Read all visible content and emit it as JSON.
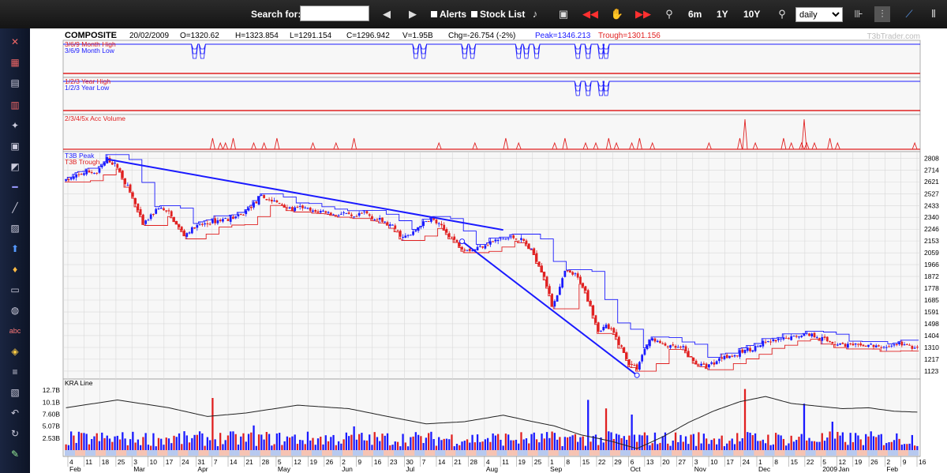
{
  "toolbar": {
    "search_label": "Search for:",
    "search_value": "",
    "alerts_label": "Alerts",
    "stocklist_label": "Stock List",
    "range_6m": "6m",
    "range_1y": "1Y",
    "range_10y": "10Y",
    "period_value": "daily",
    "period_options": [
      "daily"
    ]
  },
  "icons": {
    "prev": "chevron-left-icon",
    "next": "chevron-right-icon",
    "bell": "bell-icon",
    "camera": "camera-icon",
    "rewind": "rewind-icon",
    "hand": "hand-icon",
    "forward": "fast-forward-icon",
    "zoom_in": "zoom-in-icon",
    "zoom_out": "zoom-out-icon"
  },
  "colors": {
    "up": "#1a1aff",
    "down": "#e02020",
    "peak": "#1a1aff",
    "trough": "#e02020",
    "grid": "#d8d8d8",
    "plot_bg": "#f7f7f7",
    "accent_band_a": "#b7c9ef",
    "accent_band_b": "#f6c3b3"
  },
  "header": {
    "symbol": "COMPOSITE",
    "date": "20/02/2009",
    "open": "O=1320.62",
    "high": "H=1323.854",
    "low": "L=1291.154",
    "close": "C=1296.942",
    "volume": "V=1.95B",
    "change": "Chg=-26.754 (-2%)",
    "peak": "Peak=1346.213",
    "trough": "Trough=1301.156",
    "watermark": "T3bTrader.com"
  },
  "panels": {
    "month_high": "3/6/9 Month High",
    "month_low": "3/6/9 Month Low",
    "year_high": "1/2/3 Year High",
    "year_low": "1/2/3 Year Low",
    "acc_volume": "2/3/4/5x Acc Volume",
    "t3b_peak": "T3B Peak",
    "t3b_trough": "T3B Trough",
    "kra": "KRA Line"
  },
  "chart_data": {
    "type": "candlestick",
    "price_axis": {
      "ticks": [
        2808,
        2714,
        2621,
        2527,
        2433,
        2340,
        2246,
        2153,
        2059,
        1966,
        1872,
        1778,
        1685,
        1591,
        1498,
        1404,
        1310,
        1217,
        1123
      ],
      "ylim": [
        1060,
        2860
      ]
    },
    "volume_axis": {
      "ticks": [
        "12.7B",
        "10.1B",
        "7.60B",
        "5.07B",
        "2.53B"
      ],
      "values": [
        12.7,
        10.1,
        7.6,
        5.07,
        2.53
      ],
      "ylim": [
        0,
        14
      ]
    },
    "x_axis": {
      "day_labels": [
        "4",
        "11",
        "18",
        "25",
        "3",
        "10",
        "17",
        "24",
        "31",
        "7",
        "14",
        "21",
        "28",
        "5",
        "12",
        "19",
        "26",
        "2",
        "9",
        "16",
        "23",
        "30",
        "7",
        "14",
        "21",
        "28",
        "4",
        "11",
        "19",
        "25",
        "1",
        "8",
        "15",
        "22",
        "29",
        "6",
        "13",
        "20",
        "27",
        "3",
        "10",
        "17",
        "24",
        "1",
        "8",
        "15",
        "22",
        "5",
        "12",
        "19",
        "26",
        "2",
        "9",
        "16"
      ],
      "month_labels": [
        "Feb",
        "Mar",
        "Apr",
        "May",
        "Jun",
        "Jul",
        "Aug",
        "Sep",
        "Oct",
        "Nov",
        "Dec",
        "2009",
        "Jan",
        "Feb"
      ]
    },
    "price_anchors": [
      [
        0,
        2630
      ],
      [
        8,
        2700
      ],
      [
        12,
        2690
      ],
      [
        16,
        2800
      ],
      [
        20,
        2740
      ],
      [
        26,
        2500
      ],
      [
        30,
        2280
      ],
      [
        36,
        2420
      ],
      [
        40,
        2370
      ],
      [
        46,
        2200
      ],
      [
        50,
        2260
      ],
      [
        56,
        2300
      ],
      [
        62,
        2330
      ],
      [
        68,
        2350
      ],
      [
        72,
        2430
      ],
      [
        76,
        2500
      ],
      [
        80,
        2470
      ],
      [
        84,
        2440
      ],
      [
        88,
        2400
      ],
      [
        92,
        2420
      ],
      [
        96,
        2380
      ],
      [
        100,
        2390
      ],
      [
        104,
        2360
      ],
      [
        108,
        2370
      ],
      [
        112,
        2330
      ],
      [
        116,
        2380
      ],
      [
        120,
        2330
      ],
      [
        124,
        2300
      ],
      [
        128,
        2250
      ],
      [
        131,
        2180
      ],
      [
        134,
        2200
      ],
      [
        138,
        2280
      ],
      [
        142,
        2330
      ],
      [
        146,
        2260
      ],
      [
        150,
        2180
      ],
      [
        154,
        2100
      ],
      [
        158,
        2080
      ],
      [
        162,
        2120
      ],
      [
        166,
        2150
      ],
      [
        170,
        2170
      ],
      [
        174,
        2180
      ],
      [
        178,
        2150
      ],
      [
        182,
        2050
      ],
      [
        186,
        1880
      ],
      [
        189,
        1640
      ],
      [
        192,
        1780
      ],
      [
        194,
        1910
      ],
      [
        198,
        1880
      ],
      [
        201,
        1800
      ],
      [
        204,
        1650
      ],
      [
        207,
        1440
      ],
      [
        210,
        1480
      ],
      [
        213,
        1420
      ],
      [
        216,
        1310
      ],
      [
        219,
        1180
      ],
      [
        222,
        1150
      ],
      [
        225,
        1300
      ],
      [
        228,
        1380
      ],
      [
        232,
        1330
      ],
      [
        236,
        1310
      ],
      [
        240,
        1300
      ],
      [
        244,
        1200
      ],
      [
        248,
        1160
      ],
      [
        252,
        1190
      ],
      [
        256,
        1250
      ],
      [
        260,
        1240
      ],
      [
        264,
        1290
      ],
      [
        268,
        1310
      ],
      [
        272,
        1350
      ],
      [
        276,
        1360
      ],
      [
        280,
        1380
      ],
      [
        284,
        1400
      ],
      [
        288,
        1420
      ],
      [
        292,
        1400
      ],
      [
        296,
        1360
      ],
      [
        300,
        1340
      ],
      [
        304,
        1330
      ],
      [
        308,
        1320
      ],
      [
        312,
        1330
      ],
      [
        316,
        1310
      ],
      [
        320,
        1320
      ],
      [
        324,
        1340
      ],
      [
        328,
        1320
      ],
      [
        331,
        1300
      ]
    ],
    "trendlines": [
      {
        "from": [
          16,
          2800
        ],
        "to": [
          170,
          2240
        ]
      },
      {
        "from": [
          154,
          2150
        ],
        "to": [
          222,
          1090
        ]
      }
    ],
    "kra_anchors": [
      [
        0,
        0.72
      ],
      [
        20,
        0.9
      ],
      [
        40,
        0.72
      ],
      [
        55,
        0.52
      ],
      [
        70,
        0.6
      ],
      [
        90,
        0.78
      ],
      [
        110,
        0.7
      ],
      [
        125,
        0.52
      ],
      [
        140,
        0.35
      ],
      [
        155,
        0.4
      ],
      [
        170,
        0.55
      ],
      [
        180,
        0.42
      ],
      [
        190,
        0.3
      ],
      [
        200,
        0.1
      ],
      [
        212,
        -0.05
      ],
      [
        222,
        -0.22
      ],
      [
        232,
        0.05
      ],
      [
        242,
        0.38
      ],
      [
        252,
        0.65
      ],
      [
        262,
        0.86
      ],
      [
        272,
        0.98
      ],
      [
        282,
        0.82
      ],
      [
        292,
        0.76
      ],
      [
        302,
        0.7
      ],
      [
        312,
        0.72
      ],
      [
        322,
        0.64
      ],
      [
        331,
        0.62
      ]
    ],
    "volume_spikes": [
      [
        57,
        11.0
      ],
      [
        73,
        5.2
      ],
      [
        112,
        5.0
      ],
      [
        203,
        10.6
      ],
      [
        210,
        8.8
      ],
      [
        220,
        7.5
      ],
      [
        264,
        12.9
      ],
      [
        287,
        9.8
      ],
      [
        298,
        6.0
      ]
    ],
    "acc_volume_spikes": [
      57,
      60,
      62,
      65,
      73,
      77,
      82,
      96,
      105,
      112,
      145,
      159,
      171,
      176,
      190,
      194,
      202,
      206,
      211,
      214,
      220,
      223,
      228,
      250,
      262,
      264,
      268,
      279,
      282,
      286,
      287,
      288,
      291,
      297,
      300,
      330
    ],
    "month_signal_dips": [
      50,
      53,
      136,
      139,
      155,
      158,
      176,
      179,
      183,
      199,
      203,
      208,
      210
    ]
  }
}
